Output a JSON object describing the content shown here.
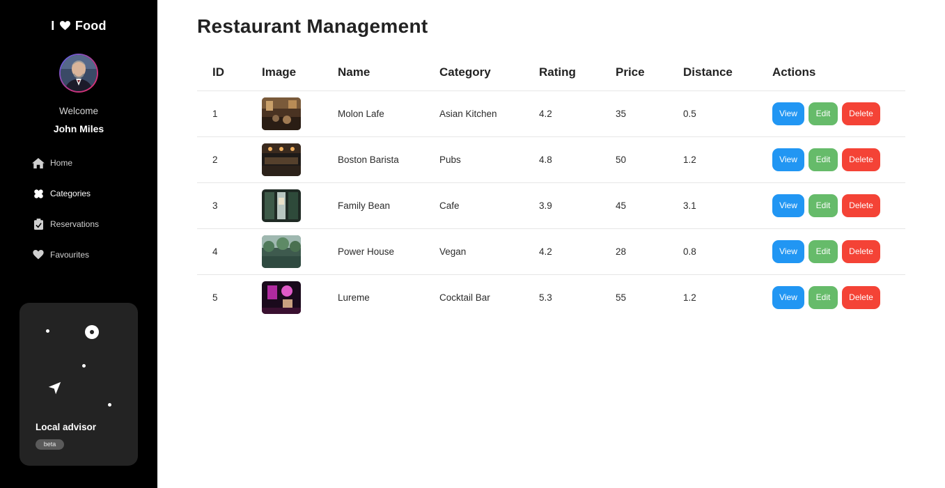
{
  "brand": {
    "text_left": "I",
    "text_right": "Food",
    "heart_icon": "heart-icon"
  },
  "profile": {
    "welcome": "Welcome",
    "name": "John Miles"
  },
  "nav": [
    {
      "label": "Home",
      "icon": "home-icon"
    },
    {
      "label": "Categories",
      "icon": "categories-icon"
    },
    {
      "label": "Reservations",
      "icon": "clipboard-icon"
    },
    {
      "label": "Favourites",
      "icon": "heart-icon"
    }
  ],
  "advisor": {
    "title": "Local advisor",
    "badge": "beta",
    "icon": "navigation-arrow-icon"
  },
  "main": {
    "title": "Restaurant Management",
    "columns": [
      "ID",
      "Image",
      "Name",
      "Category",
      "Rating",
      "Price",
      "Distance",
      "Actions"
    ],
    "rows": [
      {
        "id": "1",
        "name": "Molon Lafe",
        "category": "Asian Kitchen",
        "rating": "4.2",
        "price": "35",
        "distance": "0.5"
      },
      {
        "id": "2",
        "name": "Boston Barista",
        "category": "Pubs",
        "rating": "4.8",
        "price": "50",
        "distance": "1.2"
      },
      {
        "id": "3",
        "name": "Family Bean",
        "category": "Cafe",
        "rating": "3.9",
        "price": "45",
        "distance": "3.1"
      },
      {
        "id": "4",
        "name": "Power House",
        "category": "Vegan",
        "rating": "4.2",
        "price": "28",
        "distance": "0.8"
      },
      {
        "id": "5",
        "name": "Lureme",
        "category": "Cocktail Bar",
        "rating": "5.3",
        "price": "55",
        "distance": "1.2"
      }
    ],
    "actions": {
      "view": "View",
      "edit": "Edit",
      "delete": "Delete"
    }
  },
  "colors": {
    "view": "#2196f3",
    "edit": "#66bb6a",
    "delete": "#f44336",
    "sidebar": "#000000"
  }
}
